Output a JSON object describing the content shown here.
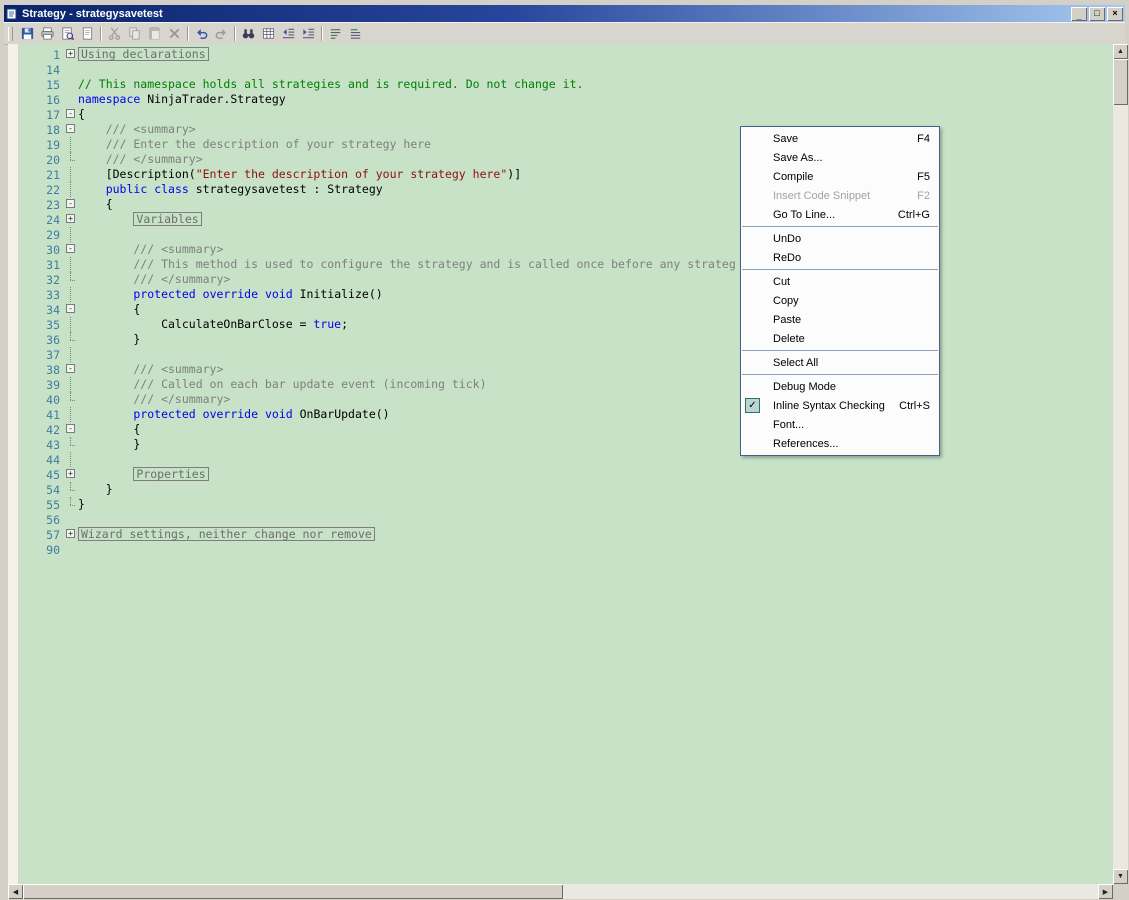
{
  "window": {
    "title": "Strategy - strategysavetest",
    "controls": {
      "minimize": "_",
      "maximize": "□",
      "close": "×"
    }
  },
  "colors": {
    "titlebar_from": "#0a246a",
    "titlebar_to": "#a6caf0",
    "editor_bg": "#c7e2c7",
    "line_number": "#3e7da2",
    "keyword": "#0000ee",
    "comment": "#007f00",
    "doc_comment": "#7f7f7f",
    "string": "#8e1010",
    "menu_border": "#44618c"
  },
  "toolbar": {
    "buttons": [
      {
        "name": "save-button",
        "icon": "save-icon"
      },
      {
        "name": "print-button",
        "icon": "print-icon"
      },
      {
        "name": "print-preview-button",
        "icon": "print-preview-icon"
      },
      {
        "name": "page-setup-button",
        "icon": "page-setup-icon"
      },
      {
        "sep": true
      },
      {
        "name": "cut-button",
        "icon": "cut-icon",
        "disabled": true
      },
      {
        "name": "copy-button",
        "icon": "copy-icon",
        "disabled": true
      },
      {
        "name": "paste-button",
        "icon": "paste-icon",
        "disabled": true
      },
      {
        "name": "delete-button",
        "icon": "delete-icon",
        "disabled": true
      },
      {
        "sep": true
      },
      {
        "name": "undo-button",
        "icon": "undo-icon"
      },
      {
        "name": "redo-button",
        "icon": "redo-icon",
        "disabled": true
      },
      {
        "sep": true
      },
      {
        "name": "find-button",
        "icon": "find-icon"
      },
      {
        "name": "insert-code-snippet-button",
        "icon": "grid-icon"
      },
      {
        "name": "outdent-button",
        "icon": "outdent-icon"
      },
      {
        "name": "indent-button",
        "icon": "indent-icon"
      },
      {
        "sep": true
      },
      {
        "name": "comment-lines-button",
        "icon": "comment-lines-icon"
      },
      {
        "name": "uncomment-lines-button",
        "icon": "uncomment-lines-icon"
      }
    ]
  },
  "editor": {
    "fold_plus": "+",
    "fold_minus": "-",
    "lines": [
      {
        "n": "1",
        "fold": "plus",
        "tokens": [
          {
            "c": "region",
            "t": "Using declarations"
          }
        ]
      },
      {
        "n": "14",
        "fold": "",
        "tokens": []
      },
      {
        "n": "15",
        "fold": "",
        "tokens": [
          {
            "c": "comment",
            "t": "// This namespace holds all strategies and is required. Do not change it."
          }
        ]
      },
      {
        "n": "16",
        "fold": "",
        "tokens": [
          {
            "c": "kw",
            "t": "namespace"
          },
          {
            "c": "plain",
            "t": " NinjaTrader.Strategy"
          }
        ]
      },
      {
        "n": "17",
        "fold": "minus",
        "tokens": [
          {
            "c": "plain",
            "t": "{"
          }
        ]
      },
      {
        "n": "18",
        "fold": "minus",
        "tokens": [
          {
            "c": "doc",
            "t": "    /// <summary>"
          }
        ]
      },
      {
        "n": "19",
        "fold": "line",
        "tokens": [
          {
            "c": "doc",
            "t": "    /// Enter the description of your strategy here"
          }
        ]
      },
      {
        "n": "20",
        "fold": "end",
        "tokens": [
          {
            "c": "doc",
            "t": "    /// </summary>"
          }
        ]
      },
      {
        "n": "21",
        "fold": "line",
        "tokens": [
          {
            "c": "plain",
            "t": "    [Description("
          },
          {
            "c": "str",
            "t": "\"Enter the description of your strategy here\""
          },
          {
            "c": "plain",
            "t": ")]"
          }
        ]
      },
      {
        "n": "22",
        "fold": "line",
        "tokens": [
          {
            "c": "plain",
            "t": "    "
          },
          {
            "c": "kw",
            "t": "public"
          },
          {
            "c": "plain",
            "t": " "
          },
          {
            "c": "kw",
            "t": "class"
          },
          {
            "c": "plain",
            "t": " strategysavetest : Strategy"
          }
        ]
      },
      {
        "n": "23",
        "fold": "minus",
        "tokens": [
          {
            "c": "plain",
            "t": "    {"
          }
        ]
      },
      {
        "n": "24",
        "fold": "plus",
        "tokens": [
          {
            "c": "plain",
            "t": "        "
          },
          {
            "c": "region",
            "t": "Variables"
          }
        ]
      },
      {
        "n": "29",
        "fold": "line",
        "tokens": []
      },
      {
        "n": "30",
        "fold": "minus",
        "tokens": [
          {
            "c": "doc",
            "t": "        /// <summary>"
          }
        ]
      },
      {
        "n": "31",
        "fold": "line",
        "tokens": [
          {
            "c": "doc",
            "t": "        /// This method is used to configure the strategy and is called once before any strateg"
          }
        ]
      },
      {
        "n": "32",
        "fold": "end",
        "tokens": [
          {
            "c": "doc",
            "t": "        /// </summary>"
          }
        ]
      },
      {
        "n": "33",
        "fold": "line",
        "tokens": [
          {
            "c": "plain",
            "t": "        "
          },
          {
            "c": "kw",
            "t": "protected"
          },
          {
            "c": "plain",
            "t": " "
          },
          {
            "c": "kw",
            "t": "override"
          },
          {
            "c": "plain",
            "t": " "
          },
          {
            "c": "kw",
            "t": "void"
          },
          {
            "c": "plain",
            "t": " Initialize()"
          }
        ]
      },
      {
        "n": "34",
        "fold": "minus",
        "tokens": [
          {
            "c": "plain",
            "t": "        {"
          }
        ]
      },
      {
        "n": "35",
        "fold": "line",
        "tokens": [
          {
            "c": "plain",
            "t": "            CalculateOnBarClose = "
          },
          {
            "c": "kw",
            "t": "true"
          },
          {
            "c": "plain",
            "t": ";"
          }
        ]
      },
      {
        "n": "36",
        "fold": "end",
        "tokens": [
          {
            "c": "plain",
            "t": "        }"
          }
        ]
      },
      {
        "n": "37",
        "fold": "line",
        "tokens": []
      },
      {
        "n": "38",
        "fold": "minus",
        "tokens": [
          {
            "c": "doc",
            "t": "        /// <summary>"
          }
        ]
      },
      {
        "n": "39",
        "fold": "line",
        "tokens": [
          {
            "c": "doc",
            "t": "        /// Called on each bar update event (incoming tick)"
          }
        ]
      },
      {
        "n": "40",
        "fold": "end",
        "tokens": [
          {
            "c": "doc",
            "t": "        /// </summary>"
          }
        ]
      },
      {
        "n": "41",
        "fold": "line",
        "tokens": [
          {
            "c": "plain",
            "t": "        "
          },
          {
            "c": "kw",
            "t": "protected"
          },
          {
            "c": "plain",
            "t": " "
          },
          {
            "c": "kw",
            "t": "override"
          },
          {
            "c": "plain",
            "t": " "
          },
          {
            "c": "kw",
            "t": "void"
          },
          {
            "c": "plain",
            "t": " OnBarUpdate()"
          }
        ]
      },
      {
        "n": "42",
        "fold": "minus",
        "tokens": [
          {
            "c": "plain",
            "t": "        {"
          }
        ]
      },
      {
        "n": "43",
        "fold": "end",
        "tokens": [
          {
            "c": "plain",
            "t": "        }"
          }
        ]
      },
      {
        "n": "44",
        "fold": "line",
        "tokens": []
      },
      {
        "n": "45",
        "fold": "plus",
        "tokens": [
          {
            "c": "plain",
            "t": "        "
          },
          {
            "c": "region",
            "t": "Properties"
          }
        ]
      },
      {
        "n": "54",
        "fold": "end",
        "tokens": [
          {
            "c": "plain",
            "t": "    }"
          }
        ]
      },
      {
        "n": "55",
        "fold": "end",
        "tokens": [
          {
            "c": "plain",
            "t": "}"
          }
        ]
      },
      {
        "n": "56",
        "fold": "",
        "tokens": []
      },
      {
        "n": "57",
        "fold": "plus",
        "tokens": [
          {
            "c": "region",
            "t": "Wizard settings, neither change nor remove"
          }
        ]
      },
      {
        "n": "90",
        "fold": "",
        "tokens": []
      }
    ]
  },
  "menu": {
    "check_glyph": "✓",
    "items": [
      {
        "label": "Save",
        "shortcut": "F4"
      },
      {
        "label": "Save As..."
      },
      {
        "label": "Compile",
        "shortcut": "F5"
      },
      {
        "label": "Insert Code Snippet",
        "shortcut": "F2",
        "disabled": true
      },
      {
        "label": "Go To Line...",
        "shortcut": "Ctrl+G"
      },
      {
        "sep": true
      },
      {
        "label": "UnDo"
      },
      {
        "label": "ReDo"
      },
      {
        "sep": true
      },
      {
        "label": "Cut"
      },
      {
        "label": "Copy"
      },
      {
        "label": "Paste"
      },
      {
        "label": "Delete"
      },
      {
        "sep": true
      },
      {
        "label": "Select All"
      },
      {
        "sep": true
      },
      {
        "label": "Debug Mode"
      },
      {
        "label": "Inline Syntax Checking",
        "shortcut": "Ctrl+S",
        "checked": true
      },
      {
        "label": "Font..."
      },
      {
        "label": "References..."
      }
    ]
  },
  "scrollbars": {
    "up": "▲",
    "down": "▼",
    "left": "◀",
    "right": "▶"
  }
}
